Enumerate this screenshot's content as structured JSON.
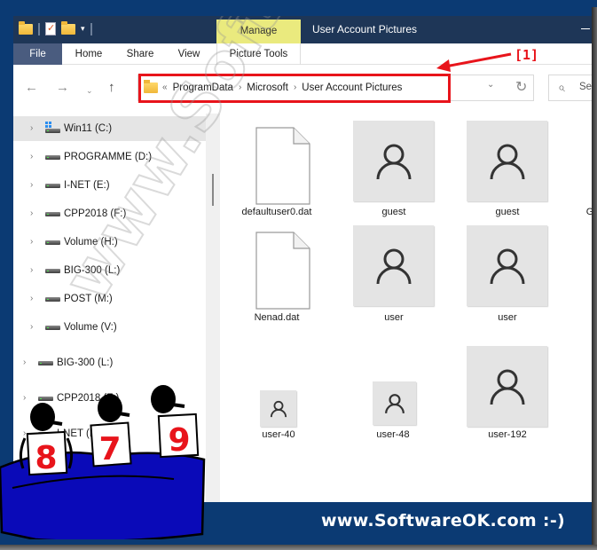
{
  "window": {
    "title": "User Account Pictures",
    "contextual_tab_group": "Manage"
  },
  "quick_access_toolbar": {
    "icons": [
      "folder-icon",
      "properties-icon",
      "new-folder-icon",
      "customize-dropdown-icon"
    ]
  },
  "ribbon": {
    "tabs": [
      {
        "label": "File"
      },
      {
        "label": "Home"
      },
      {
        "label": "Share"
      },
      {
        "label": "View"
      },
      {
        "label": "Picture Tools"
      }
    ]
  },
  "nav": {
    "back": "←",
    "forward": "→",
    "recent": "⌄",
    "up": "↑"
  },
  "address": {
    "overflow": "«",
    "separator": "›",
    "crumbs": [
      "ProgramData",
      "Microsoft",
      "User Account Pictures"
    ],
    "dropdown": "⌄",
    "refresh": "↻"
  },
  "search": {
    "icon": "⌕",
    "placeholder": "Se"
  },
  "annotation": {
    "label": "[1]",
    "color": "#e8141b"
  },
  "sidebar": {
    "chevron": "›",
    "items": [
      {
        "label": "Win11 (C:)",
        "icon": "windows-drive-icon",
        "selected": true
      },
      {
        "label": "PROGRAMME (D:)",
        "icon": "drive-icon"
      },
      {
        "label": "I-NET (E:)",
        "icon": "drive-icon"
      },
      {
        "label": "CPP2018 (F:)",
        "icon": "drive-icon"
      },
      {
        "label": "Volume (H:)",
        "icon": "drive-icon"
      },
      {
        "label": "BIG-300 (L:)",
        "icon": "drive-icon"
      },
      {
        "label": "POST (M:)",
        "icon": "drive-icon"
      },
      {
        "label": "Volume (V:)",
        "icon": "drive-icon"
      },
      {
        "label": "BIG-300 (L:)",
        "icon": "drive-icon"
      },
      {
        "label": "CPP2018 (F:)",
        "icon": "drive-icon"
      },
      {
        "label": "I-NET (E:)",
        "icon": "drive-icon"
      }
    ]
  },
  "files": [
    {
      "name": "defaultuser0.dat",
      "type": "document"
    },
    {
      "name": "guest",
      "type": "picture"
    },
    {
      "name": "guest",
      "type": "picture"
    },
    {
      "name": "Nenad.dat",
      "type": "document"
    },
    {
      "name": "user",
      "type": "picture"
    },
    {
      "name": "user",
      "type": "picture"
    },
    {
      "name": "user-40",
      "type": "picture"
    },
    {
      "name": "user-48",
      "type": "picture"
    },
    {
      "name": "user-192",
      "type": "picture"
    }
  ],
  "partially_visible_file_initial": "G",
  "footer": {
    "text": "www.SoftwareOK.com :-)"
  },
  "watermark": {
    "text": "www.SoftwareOK.com"
  },
  "mascots": {
    "scores": [
      "8",
      "7",
      "9"
    ],
    "score_color": "#e8141b",
    "table_color": "#0a0ab8"
  }
}
